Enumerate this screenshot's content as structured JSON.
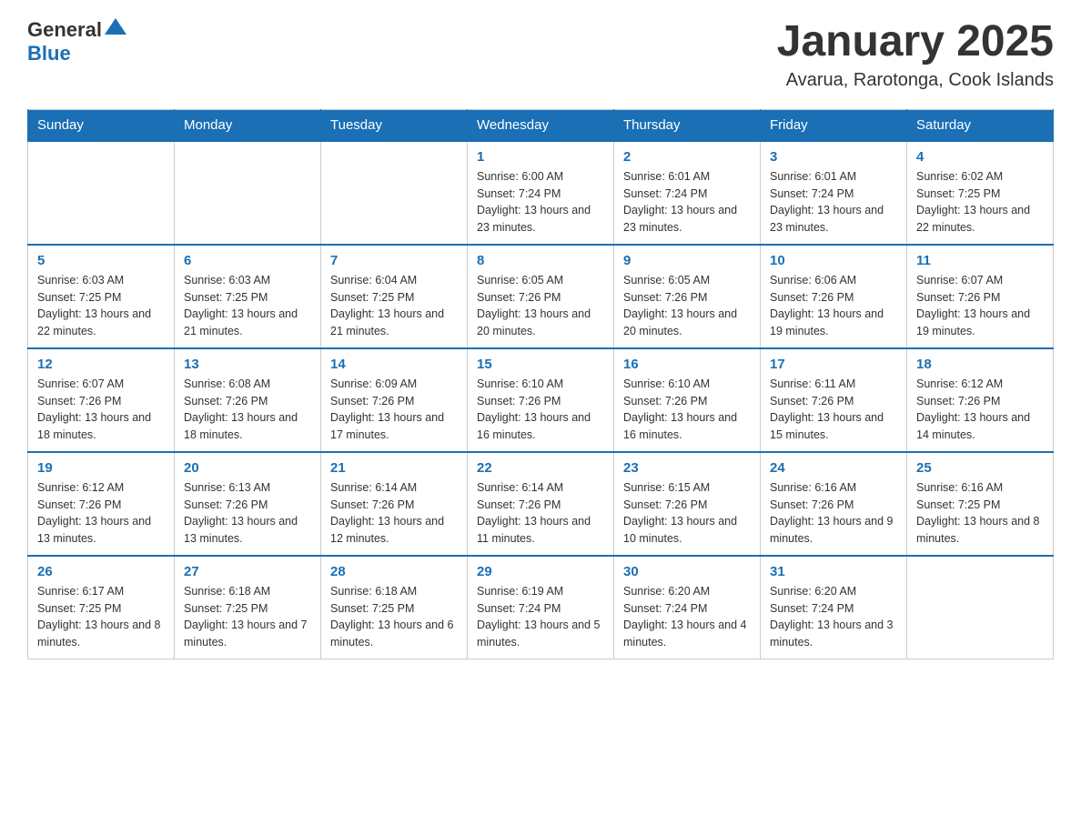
{
  "header": {
    "logo": {
      "text_general": "General",
      "text_blue": "Blue",
      "alt": "GeneralBlue logo"
    },
    "title": "January 2025",
    "location": "Avarua, Rarotonga, Cook Islands"
  },
  "calendar": {
    "days_of_week": [
      "Sunday",
      "Monday",
      "Tuesday",
      "Wednesday",
      "Thursday",
      "Friday",
      "Saturday"
    ],
    "weeks": [
      [
        {
          "day": "",
          "info": ""
        },
        {
          "day": "",
          "info": ""
        },
        {
          "day": "",
          "info": ""
        },
        {
          "day": "1",
          "info": "Sunrise: 6:00 AM\nSunset: 7:24 PM\nDaylight: 13 hours and 23 minutes."
        },
        {
          "day": "2",
          "info": "Sunrise: 6:01 AM\nSunset: 7:24 PM\nDaylight: 13 hours and 23 minutes."
        },
        {
          "day": "3",
          "info": "Sunrise: 6:01 AM\nSunset: 7:24 PM\nDaylight: 13 hours and 23 minutes."
        },
        {
          "day": "4",
          "info": "Sunrise: 6:02 AM\nSunset: 7:25 PM\nDaylight: 13 hours and 22 minutes."
        }
      ],
      [
        {
          "day": "5",
          "info": "Sunrise: 6:03 AM\nSunset: 7:25 PM\nDaylight: 13 hours and 22 minutes."
        },
        {
          "day": "6",
          "info": "Sunrise: 6:03 AM\nSunset: 7:25 PM\nDaylight: 13 hours and 21 minutes."
        },
        {
          "day": "7",
          "info": "Sunrise: 6:04 AM\nSunset: 7:25 PM\nDaylight: 13 hours and 21 minutes."
        },
        {
          "day": "8",
          "info": "Sunrise: 6:05 AM\nSunset: 7:26 PM\nDaylight: 13 hours and 20 minutes."
        },
        {
          "day": "9",
          "info": "Sunrise: 6:05 AM\nSunset: 7:26 PM\nDaylight: 13 hours and 20 minutes."
        },
        {
          "day": "10",
          "info": "Sunrise: 6:06 AM\nSunset: 7:26 PM\nDaylight: 13 hours and 19 minutes."
        },
        {
          "day": "11",
          "info": "Sunrise: 6:07 AM\nSunset: 7:26 PM\nDaylight: 13 hours and 19 minutes."
        }
      ],
      [
        {
          "day": "12",
          "info": "Sunrise: 6:07 AM\nSunset: 7:26 PM\nDaylight: 13 hours and 18 minutes."
        },
        {
          "day": "13",
          "info": "Sunrise: 6:08 AM\nSunset: 7:26 PM\nDaylight: 13 hours and 18 minutes."
        },
        {
          "day": "14",
          "info": "Sunrise: 6:09 AM\nSunset: 7:26 PM\nDaylight: 13 hours and 17 minutes."
        },
        {
          "day": "15",
          "info": "Sunrise: 6:10 AM\nSunset: 7:26 PM\nDaylight: 13 hours and 16 minutes."
        },
        {
          "day": "16",
          "info": "Sunrise: 6:10 AM\nSunset: 7:26 PM\nDaylight: 13 hours and 16 minutes."
        },
        {
          "day": "17",
          "info": "Sunrise: 6:11 AM\nSunset: 7:26 PM\nDaylight: 13 hours and 15 minutes."
        },
        {
          "day": "18",
          "info": "Sunrise: 6:12 AM\nSunset: 7:26 PM\nDaylight: 13 hours and 14 minutes."
        }
      ],
      [
        {
          "day": "19",
          "info": "Sunrise: 6:12 AM\nSunset: 7:26 PM\nDaylight: 13 hours and 13 minutes."
        },
        {
          "day": "20",
          "info": "Sunrise: 6:13 AM\nSunset: 7:26 PM\nDaylight: 13 hours and 13 minutes."
        },
        {
          "day": "21",
          "info": "Sunrise: 6:14 AM\nSunset: 7:26 PM\nDaylight: 13 hours and 12 minutes."
        },
        {
          "day": "22",
          "info": "Sunrise: 6:14 AM\nSunset: 7:26 PM\nDaylight: 13 hours and 11 minutes."
        },
        {
          "day": "23",
          "info": "Sunrise: 6:15 AM\nSunset: 7:26 PM\nDaylight: 13 hours and 10 minutes."
        },
        {
          "day": "24",
          "info": "Sunrise: 6:16 AM\nSunset: 7:26 PM\nDaylight: 13 hours and 9 minutes."
        },
        {
          "day": "25",
          "info": "Sunrise: 6:16 AM\nSunset: 7:25 PM\nDaylight: 13 hours and 8 minutes."
        }
      ],
      [
        {
          "day": "26",
          "info": "Sunrise: 6:17 AM\nSunset: 7:25 PM\nDaylight: 13 hours and 8 minutes."
        },
        {
          "day": "27",
          "info": "Sunrise: 6:18 AM\nSunset: 7:25 PM\nDaylight: 13 hours and 7 minutes."
        },
        {
          "day": "28",
          "info": "Sunrise: 6:18 AM\nSunset: 7:25 PM\nDaylight: 13 hours and 6 minutes."
        },
        {
          "day": "29",
          "info": "Sunrise: 6:19 AM\nSunset: 7:24 PM\nDaylight: 13 hours and 5 minutes."
        },
        {
          "day": "30",
          "info": "Sunrise: 6:20 AM\nSunset: 7:24 PM\nDaylight: 13 hours and 4 minutes."
        },
        {
          "day": "31",
          "info": "Sunrise: 6:20 AM\nSunset: 7:24 PM\nDaylight: 13 hours and 3 minutes."
        },
        {
          "day": "",
          "info": ""
        }
      ]
    ]
  }
}
